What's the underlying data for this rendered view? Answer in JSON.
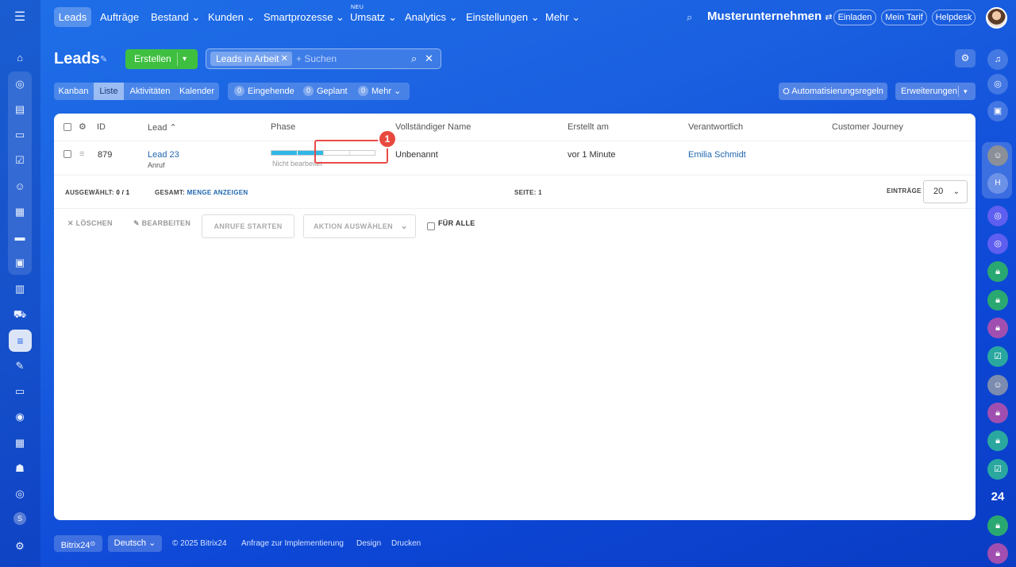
{
  "nav": {
    "items": [
      "Leads",
      "Aufträge",
      "Bestand",
      "Kunden",
      "Smartprozesse",
      "Umsatz",
      "Analytics",
      "Einstellungen",
      "Mehr"
    ],
    "neu_badge": "NEU",
    "company": "Musterunternehmen",
    "invite": "Einladen",
    "tariff": "Mein Tarif",
    "helpdesk": "Helpdesk"
  },
  "page": {
    "title": "Leads",
    "create_label": "Erstellen",
    "filter_tag": "Leads in Arbeit",
    "search_placeholder": "+ Suchen"
  },
  "views": [
    "Kanban",
    "Liste",
    "Aktivitäten",
    "Kalender"
  ],
  "active_view": "Liste",
  "counters": [
    {
      "count": "0",
      "label": "Eingehende"
    },
    {
      "count": "0",
      "label": "Geplant"
    },
    {
      "count": "0",
      "label": "Mehr"
    }
  ],
  "toolbar": {
    "automation": "Automatisierungsregeln",
    "extensions": "Erweiterungen"
  },
  "table": {
    "headers": [
      "ID",
      "Lead",
      "Phase",
      "Vollständiger Name",
      "Erstellt am",
      "Verantwortlich",
      "Customer Journey"
    ],
    "rows": [
      {
        "id": "879",
        "lead": "Lead 23",
        "lead_source": "Anruf",
        "phase_label": "Nicht bearbeitet",
        "phase_progress": 0.5,
        "full_name": "Unbenannt",
        "created": "vor 1 Minute",
        "responsible": "Emilia Schmidt"
      }
    ]
  },
  "footer_bar": {
    "selected_label": "AUSGEWÄHLT:",
    "selected_value": "0 / 1",
    "total_label": "GESAMT:",
    "total_link": "MENGE ANZEIGEN",
    "page_label": "SEITE:",
    "page_value": "1",
    "entries_label": "EINTRÄGE",
    "entries_value": "20"
  },
  "actions": {
    "delete": "LÖSCHEN",
    "edit": "BEARBEITEN",
    "calls": "ANRUFE STARTEN",
    "select_action": "AKTION AUSWÄHLEN",
    "for_all": "FÜR ALLE"
  },
  "annotation": {
    "badge": "1",
    "color": "#e8493f"
  },
  "right_bar": {
    "counter_24": "24",
    "group_letter": "H"
  },
  "left_bar": {
    "user_letter": "S"
  },
  "bottom": {
    "brand": "Bitrix24",
    "language": "Deutsch",
    "copyright": "© 2025 Bitrix24",
    "links": [
      "Anfrage zur Implementierung",
      "Design",
      "Drucken"
    ]
  },
  "colors": {
    "accent_green": "#3fbf3f",
    "phase_blue": "#2fb8e6",
    "link_blue": "#2067b0"
  }
}
